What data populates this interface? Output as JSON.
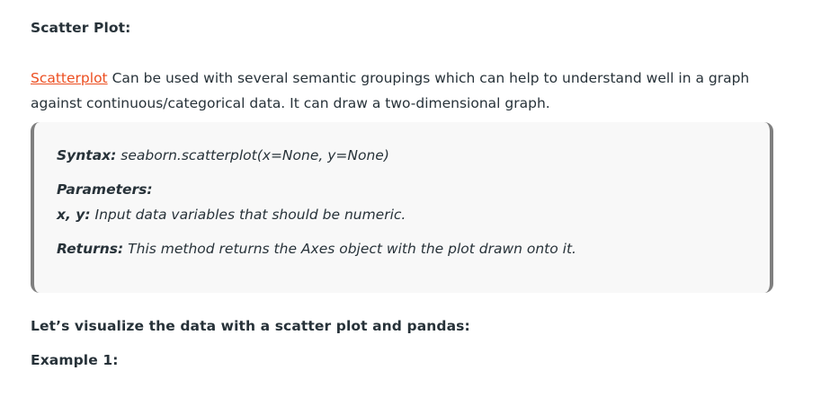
{
  "section_title": "Scatter Plot:",
  "intro": {
    "link_text": "Scatterplot",
    "text": " Can be used with several semantic groupings which can help to understand well in a graph against continuous/categorical data. It can draw a two-dimensional graph."
  },
  "syntax_box": {
    "syntax_label": "Syntax:",
    "syntax_value": " seaborn.scatterplot(x=None, y=None)",
    "parameters_label": "Parameters:",
    "param_name": "x, y:",
    "param_desc": " Input data variables that should be numeric.",
    "returns_label": "Returns:",
    "returns_desc": " This method returns the Axes object with the plot drawn onto it."
  },
  "visualize_heading": "Let’s visualize the data with a scatter plot and pandas:",
  "example_heading": "Example 1:",
  "colors": {
    "link": "#ec4e20",
    "text": "#273239",
    "box_bg": "#f8f8f8",
    "box_border": "#7f7f7f"
  }
}
